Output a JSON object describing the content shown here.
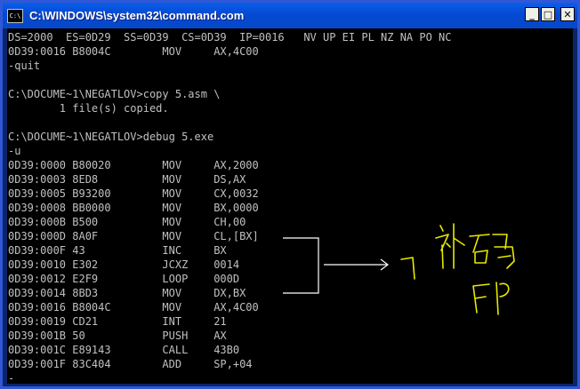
{
  "window": {
    "title": "C:\\WINDOWS\\system32\\command.com",
    "icon": "cmd-icon",
    "icon_text": "C:\\",
    "controls": {
      "minimize": "_",
      "maximize": "□",
      "close": "✕"
    }
  },
  "console": {
    "lines": [
      "DS=2000  ES=0D29  SS=0D39  CS=0D39  IP=0016   NV UP EI PL NZ NA PO NC",
      "0D39:0016 B8004C        MOV     AX,4C00",
      "-quit",
      "",
      "C:\\DOCUME~1\\NEGATLOV>copy 5.asm \\",
      "        1 file(s) copied.",
      "",
      "C:\\DOCUME~1\\NEGATLOV>debug 5.exe",
      "-u",
      "0D39:0000 B80020        MOV     AX,2000",
      "0D39:0003 8ED8          MOV     DS,AX",
      "0D39:0005 B93200        MOV     CX,0032",
      "0D39:0008 BB0000        MOV     BX,0000",
      "0D39:000B B500          MOV     CH,00",
      "0D39:000D 8A0F          MOV     CL,[BX]",
      "0D39:000F 43            INC     BX",
      "0D39:0010 E302          JCXZ    0014",
      "0D39:0012 E2F9          LOOP    000D",
      "0D39:0014 8BD3          MOV     DX,BX",
      "0D39:0016 B8004C        MOV     AX,4C00",
      "0D39:0019 CD21          INT     21",
      "0D39:001B 50            PUSH    AX",
      "0D39:001C E89143        CALL    43B0",
      "0D39:001F 83C404        ADD     SP,+04",
      "-"
    ]
  },
  "annotation": {
    "color_bracket": "#ffffff",
    "color_ink": "#e8e800",
    "text": "补码 FF"
  }
}
